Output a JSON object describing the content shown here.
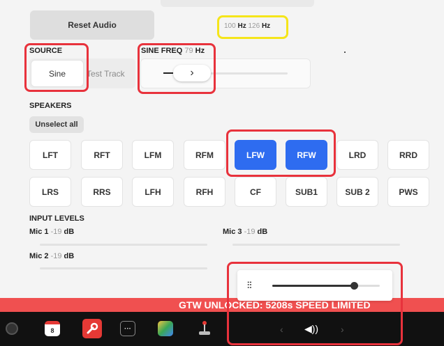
{
  "reset_audio": "Reset Audio",
  "freq_chips": {
    "a_value": "100",
    "a_unit": "Hz",
    "b_value": "126",
    "b_unit": "Hz"
  },
  "source": {
    "label": "SOURCE",
    "options": [
      "Sine",
      "Test Track"
    ],
    "selected": "Sine"
  },
  "sine_freq": {
    "label": "SINE FREQ",
    "value": "79",
    "unit": "Hz",
    "arrow": "›"
  },
  "speakers": {
    "label": "SPEAKERS",
    "unselect_all": "Unselect all",
    "row1": [
      "LFT",
      "RFT",
      "LFM",
      "RFM",
      "LFW",
      "RFW",
      "LRD",
      "RRD"
    ],
    "row2": [
      "LRS",
      "RRS",
      "LFH",
      "RFH",
      "CF",
      "SUB1",
      "SUB 2",
      "PWS"
    ],
    "selected": [
      "LFW",
      "RFW"
    ]
  },
  "input_levels": {
    "label": "INPUT LEVELS",
    "mics": [
      {
        "name": "Mic 1",
        "value": "-19",
        "unit": "dB"
      },
      {
        "name": "Mic 3",
        "value": "-19",
        "unit": "dB"
      },
      {
        "name": "Mic 2",
        "value": "-19",
        "unit": "dB"
      }
    ]
  },
  "volume_popup": {
    "level": 0.76
  },
  "alert_banner": {
    "text": "GTW UNLOCKED: 5208s   SPEED LIMITED"
  },
  "dock": {
    "calendar_day": "8"
  },
  "colors": {
    "accent": "#2e6cf0",
    "alert": "#f05050",
    "annotation_red": "#e8323c",
    "annotation_yellow": "#f5e51a"
  }
}
